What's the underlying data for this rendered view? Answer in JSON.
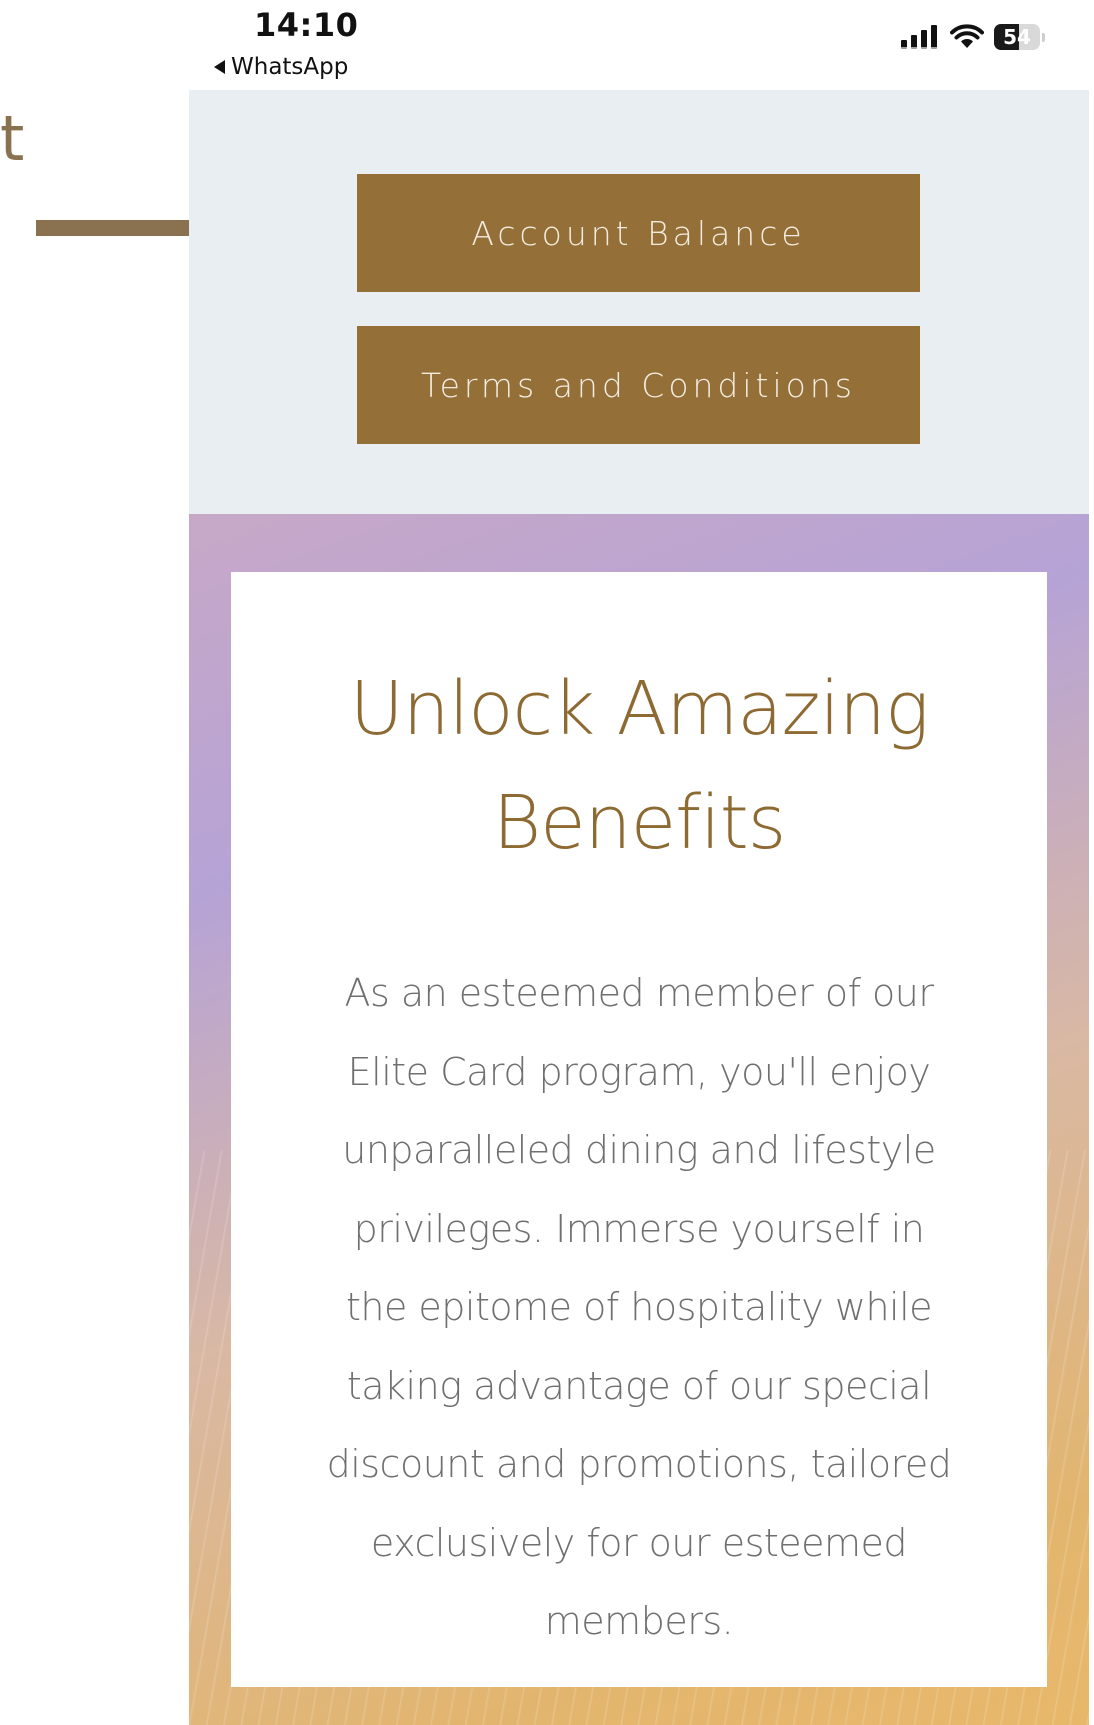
{
  "annotation": {
    "letter": "t",
    "color": "#8a7150"
  },
  "status_bar": {
    "time": "14:10",
    "back_app": "WhatsApp",
    "battery_label": "54",
    "battery_level_percent": 54,
    "icons": [
      "signal-icon",
      "wifi-icon",
      "battery-icon"
    ]
  },
  "page": {
    "buttons": {
      "account_balance": "Account Balance",
      "terms": "Terms and Conditions"
    },
    "card": {
      "title": "Unlock Amazing Benefits",
      "body": "As an esteemed member of our Elite Card program, you'll enjoy unparalleled dining and lifestyle privileges. Immerse yourself in the epitome of hospitality while taking advantage of our special discount and promotions, tailored exclusively for our esteemed members."
    }
  },
  "colors": {
    "button_bg": "#946f37",
    "title_gold": "#8e6a33",
    "panel_bg": "#e9eef2"
  }
}
